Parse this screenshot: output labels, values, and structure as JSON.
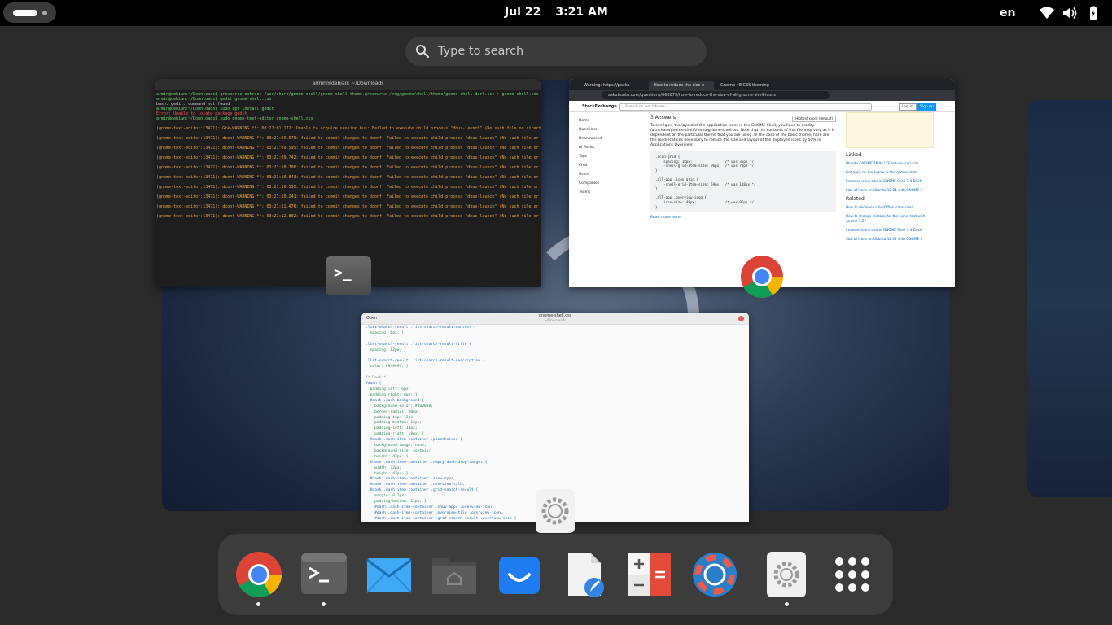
{
  "topbar": {
    "date": "Jul 22",
    "time": "3:21 AM",
    "language": "en",
    "icons": [
      "wifi-icon",
      "volume-icon",
      "battery-icon"
    ]
  },
  "search": {
    "placeholder": "Type to search"
  },
  "terminal": {
    "title": "armin@debian: ~/Downloads",
    "lines": [
      "armin@debian:~/Downloads$ gresource extract /usr/share/gnome-shell/gnome-shell-theme.gresource /org/gnome/shell/theme/gnome-shell-dark.css > gnome-shell.css",
      "armin@debian:~/Downloads$ gedit gnome-shell.css",
      "bash: gedit: command not found",
      "armin@debian:~/Downloads$ sudo apt install gedit",
      "Error: Unable to locate package gedit",
      "armin@debian:~/Downloads$ sudo gnome-text-editor gnome-shell.css",
      "",
      "(gnome-text-editor:13471): Gtk-WARNING **: 03:21:01.172: Unable to acquire session bus: Failed to execute child process \"dbus-launch\" (No such file or directory)",
      "",
      "(gnome-text-editor:13471): dconf-WARNING **: 03:21:09.575: failed to commit changes to dconf: Failed to execute child process \"dbus-launch\" (No such file or directory)",
      "",
      "(gnome-text-editor:13471): dconf-WARNING **: 03:21:09.595: failed to commit changes to dconf: Failed to execute child process \"dbus-launch\" (No such file or directory)",
      "",
      "(gnome-text-editor:13471): dconf-WARNING **: 03:21:09.742: failed to commit changes to dconf: Failed to execute child process \"dbus-launch\" (No such file or directory)",
      "",
      "(gnome-text-editor:13471): dconf-WARNING **: 03:21:10.700: failed to commit changes to dconf: Failed to execute child process \"dbus-launch\" (No such file or directory)",
      "",
      "(gnome-text-editor:13471): dconf-WARNING **: 03:21:10.843: failed to commit changes to dconf: Failed to execute child process \"dbus-launch\" (No such file or directory)",
      "",
      "(gnome-text-editor:13471): dconf-WARNING **: 03:21:10.155: failed to commit changes to dconf: Failed to execute child process \"dbus-launch\" (No such file or directory)",
      "",
      "(gnome-text-editor:13471): dconf-WARNING **: 03:21:10.241: failed to commit changes to dconf: Failed to execute child process \"dbus-launch\" (No such file or directory)",
      "",
      "(gnome-text-editor:13471): dconf-WARNING **: 03:21:11.476: failed to commit changes to dconf: Failed to execute child process \"dbus-launch\" (No such file or directory)",
      "",
      "(gnome-text-editor:13471): dconf-WARNING **: 03:21:12.802: failed to commit changes to dconf: Failed to execute child process \"dbus-launch\" (No such file or directory)"
    ]
  },
  "browser": {
    "tabs": [
      "Warning: https://packa",
      "How to reduce the size o",
      "Gnome 48 CSS theming"
    ],
    "url": "askubuntu.com/questions/668879/how-to-reduce-the-size-of-all-gnome-shell-icons",
    "site": "StackExchange",
    "search_placeholder": "Search on Ask Ubuntu...",
    "login": "Log in",
    "signup": "Sign up",
    "nav": [
      "Home",
      "Questions",
      "Unanswered",
      "AI Assist",
      "Tags",
      "Chat",
      "Users",
      "Companies",
      "Teams"
    ],
    "answers_count": "3 Answers",
    "sorted_by": "Highest score (default)",
    "answer_text": "To configure the layout of the application icons in the GNOME Shell, you have to modify /usr/share/gnome-shell/theme/gnome-shell.css. Note that the contents of this file may vary as it is dependent on the particular theme that you are using. In the case of the basic theme, here are the modifications necessary to reduce the size and layout of the displayed icons by 50% in Applications Overview:",
    "code": ".icon-grid {\n    spacing: 18px;                /* was 36px */\n    -shell-grid-item-size: 96px;  /* was 70px */\n}\n\n.all-app .icon-grid {\n    -shell-grid-item-size: 59px;  /* was 118px */\n}\n\n.all-app .overview-icon {\n    icon-size: 48px;              /* was 96px */\n}",
    "read_more": "Read more here.",
    "linked_title": "Linked",
    "linked": [
      "Ubuntu GNOME 16.04 LTS reduce icon size",
      "Get apps on bar below in the gnome shell",
      "Increase icons size in GNOME Shell 3.4 Dash",
      "Size of icons on Ubuntu 12.04 with GNOME 3"
    ],
    "related_title": "Related",
    "related": [
      "How to decrease LibreOffice icons size?",
      "How to change fontsize for the panel text with gnome 3.2?",
      "Increase icons size in GNOME Shell 3.4 Dash",
      "Size of icons on Ubuntu 12.04 with GNOME 3"
    ]
  },
  "editor": {
    "menu": "Open",
    "title": "gnome-shell.css",
    "subtitle": "~/Downloads",
    "lines": [
      ".list-search-result .list-search-result-content {",
      "  spacing: 6px; }",
      "",
      ".list-search-result .list-search-result-title {",
      "  spacing: 12px; }",
      "",
      ".list-search-result .list-search-result-description {",
      "  color: #949497; }",
      "",
      "/* Dash */",
      "#dash {",
      "  padding-left: 6px;",
      "  padding-right: 6px; }",
      "  #dash .dash-background {",
      "    background-color: #000000;",
      "    border-radius: 20px;",
      "    padding-top: 12px;",
      "    padding-bottom: 12px;",
      "    padding-left: 18px;",
      "    padding-right: 18px; }",
      "  #dash .dash-item-container .placeholder {",
      "    background-image: none;",
      "    background-size: contain;",
      "    height: 43px; }",
      "  #dash .dash-item-container .empty-dash-drop-target {",
      "    width: 32px;",
      "    height: 43px; }",
      "  #dash .dash-item-container .show-apps,",
      "  #dash .dash-item-container .overview-tile,",
      "  #dash .dash-item-container .grid-search-result {",
      "    margin: 0 2px;",
      "    padding-bottom: 12px; }",
      "    #dash .dash-item-container .show-apps .overview-icon,",
      "    #dash .dash-item-container .overview-tile .overview-icon,",
      "    #dash .dash-item-container .grid-search-result .overview-icon {"
    ]
  },
  "dock": {
    "items": [
      {
        "name": "chrome",
        "running": true
      },
      {
        "name": "terminal",
        "running": true
      },
      {
        "name": "mail",
        "running": false
      },
      {
        "name": "files",
        "running": false
      },
      {
        "name": "software",
        "running": false
      },
      {
        "name": "text-editor",
        "running": false
      },
      {
        "name": "calculator",
        "running": false
      },
      {
        "name": "help",
        "running": false
      },
      {
        "name": "settings",
        "running": true
      },
      {
        "name": "show-apps",
        "running": false
      }
    ]
  },
  "colors": {
    "topbar": "#000000",
    "dock": "#3c3c3c",
    "search": "#3b3b3b"
  }
}
